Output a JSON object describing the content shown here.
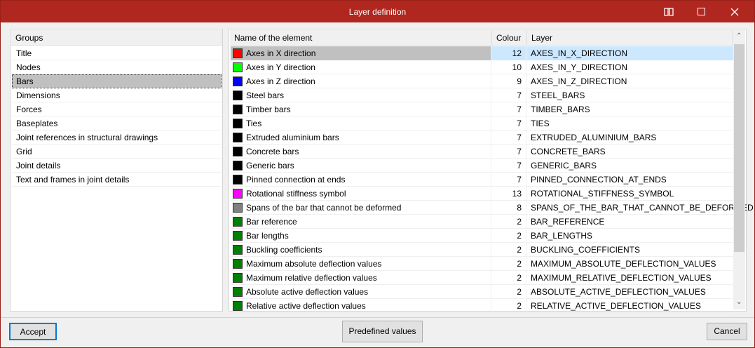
{
  "window": {
    "title": "Layer definition",
    "icons": [
      "help-book-icon",
      "maximize-icon",
      "close-icon"
    ]
  },
  "groups": {
    "header": "Groups",
    "selected": "Bars",
    "items": [
      "Title",
      "Nodes",
      "Bars",
      "Dimensions",
      "Forces",
      "Baseplates",
      "Joint references in structural drawings",
      "Grid",
      "Joint details",
      "Text and frames in joint details"
    ]
  },
  "table": {
    "headers": {
      "name": "Name of the element",
      "colour": "Colour",
      "layer": "Layer"
    },
    "rows": [
      {
        "name": "Axes in X direction",
        "colour": "12",
        "layer": "AXES_IN_X_DIRECTION",
        "swatch": "#ff0000"
      },
      {
        "name": "Axes in Y direction",
        "colour": "10",
        "layer": "AXES_IN_Y_DIRECTION",
        "swatch": "#00ff00"
      },
      {
        "name": "Axes in Z direction",
        "colour": "9",
        "layer": "AXES_IN_Z_DIRECTION",
        "swatch": "#0000ff"
      },
      {
        "name": "Steel bars",
        "colour": "7",
        "layer": "STEEL_BARS",
        "swatch": "#000000"
      },
      {
        "name": "Timber bars",
        "colour": "7",
        "layer": "TIMBER_BARS",
        "swatch": "#000000"
      },
      {
        "name": "Ties",
        "colour": "7",
        "layer": "TIES",
        "swatch": "#000000"
      },
      {
        "name": "Extruded aluminium bars",
        "colour": "7",
        "layer": "EXTRUDED_ALUMINIUM_BARS",
        "swatch": "#000000"
      },
      {
        "name": "Concrete bars",
        "colour": "7",
        "layer": "CONCRETE_BARS",
        "swatch": "#000000"
      },
      {
        "name": "Generic bars",
        "colour": "7",
        "layer": "GENERIC_BARS",
        "swatch": "#000000"
      },
      {
        "name": "Pinned connection at ends",
        "colour": "7",
        "layer": "PINNED_CONNECTION_AT_ENDS",
        "swatch": "#000000"
      },
      {
        "name": "Rotational stiffness symbol",
        "colour": "13",
        "layer": "ROTATIONAL_STIFFNESS_SYMBOL",
        "swatch": "#ff00ff"
      },
      {
        "name": "Spans of the bar that cannot be deformed",
        "colour": "8",
        "layer": "SPANS_OF_THE_BAR_THAT_CANNOT_BE_DEFORMED",
        "swatch": "#808080"
      },
      {
        "name": "Bar reference",
        "colour": "2",
        "layer": "BAR_REFERENCE",
        "swatch": "#008000"
      },
      {
        "name": "Bar lengths",
        "colour": "2",
        "layer": "BAR_LENGTHS",
        "swatch": "#008000"
      },
      {
        "name": "Buckling coefficients",
        "colour": "2",
        "layer": "BUCKLING_COEFFICIENTS",
        "swatch": "#008000"
      },
      {
        "name": "Maximum absolute deflection values",
        "colour": "2",
        "layer": "MAXIMUM_ABSOLUTE_DEFLECTION_VALUES",
        "swatch": "#008000"
      },
      {
        "name": "Maximum relative deflection values",
        "colour": "2",
        "layer": "MAXIMUM_RELATIVE_DEFLECTION_VALUES",
        "swatch": "#008000"
      },
      {
        "name": "Absolute active deflection values",
        "colour": "2",
        "layer": "ABSOLUTE_ACTIVE_DEFLECTION_VALUES",
        "swatch": "#008000"
      },
      {
        "name": "Relative active deflection values",
        "colour": "2",
        "layer": "RELATIVE_ACTIVE_DEFLECTION_VALUES",
        "swatch": "#008000"
      }
    ]
  },
  "buttons": {
    "accept": "Accept",
    "predefined": "Predefined values",
    "cancel": "Cancel"
  },
  "colors": {
    "titlebar": "#b0271f",
    "selection": "#cce8ff"
  }
}
